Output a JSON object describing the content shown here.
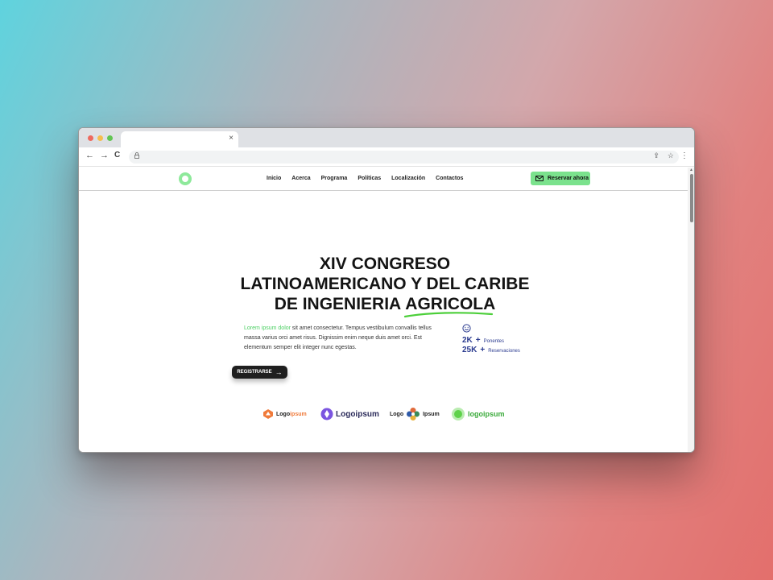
{
  "browser": {
    "colors": {
      "close": "#ee6a5f",
      "minimize": "#f5be4f",
      "maximize": "#62c554"
    },
    "tab_close": "×",
    "nav": {
      "back": "←",
      "forward": "→",
      "reload": "C"
    },
    "lock_icon": "lock-icon",
    "actions": {
      "share": "⇪",
      "bookmark": "☆",
      "menu": "⋮"
    }
  },
  "site": {
    "menu": [
      "Inicio",
      "Acerca",
      "Programa",
      "Políticas",
      "Localización",
      "Contactos"
    ],
    "reserve_label": "Reservar ahora",
    "accent": "#7be28d"
  },
  "hero": {
    "title_line1": "XIV  CONGRESO",
    "title_line2": "LATINOAMERICANO Y DEL CARIBE",
    "title_line3_pre": "DE INGENIERIA ",
    "title_line3_highlight": "AGRICOLA",
    "desc_highlight": "Lorem ipsum dolor",
    "desc_rest": " sit amet consectetur. Tempus vestibulum convallis tellus massa varius orci amet risus. Dignissim enim neque duis amet orci. Est elementum semper elit integer nunc egestas.",
    "stats": [
      {
        "num": "2K",
        "plus": "+",
        "label": "Ponentes"
      },
      {
        "num": "25K",
        "plus": "+",
        "label": "Reservaciones"
      }
    ],
    "cta_label": "REGISTRARSE",
    "cta_arrow": "→"
  },
  "logos": {
    "logo1": {
      "a": "Logo",
      "b": "ipsum"
    },
    "logo2": "Logoipsum",
    "logo3": {
      "a": "Logo",
      "b": "Ipsum"
    },
    "logo4": "logoipsum"
  }
}
